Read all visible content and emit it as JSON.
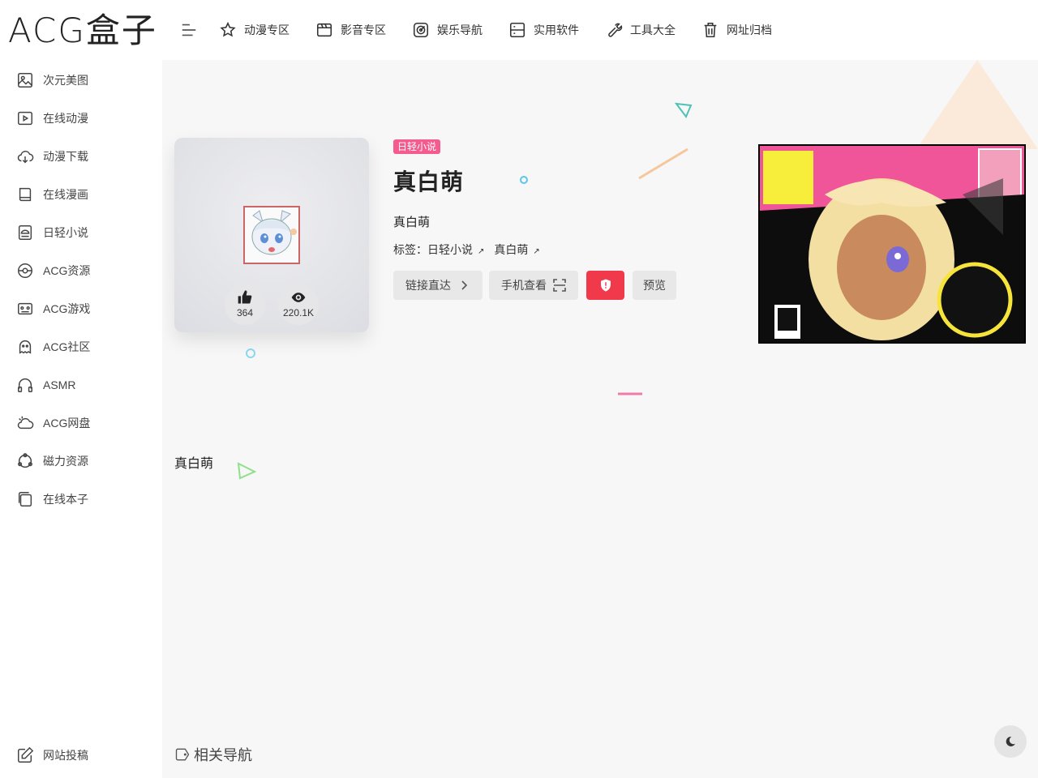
{
  "logo": "ACG盒子",
  "sidebar": {
    "items": [
      {
        "label": "次元美图",
        "icon": "image-icon"
      },
      {
        "label": "在线动漫",
        "icon": "play-icon"
      },
      {
        "label": "动漫下载",
        "icon": "cloud-download-icon"
      },
      {
        "label": "在线漫画",
        "icon": "book-icon"
      },
      {
        "label": "日轻小说",
        "icon": "novel-icon"
      },
      {
        "label": "ACG资源",
        "icon": "pokeball-icon"
      },
      {
        "label": "ACG游戏",
        "icon": "gamepad-icon"
      },
      {
        "label": "ACG社区",
        "icon": "ghost-icon"
      },
      {
        "label": "ASMR",
        "icon": "headphones-icon"
      },
      {
        "label": "ACG网盘",
        "icon": "cloud-icon"
      },
      {
        "label": "磁力资源",
        "icon": "magnet-icon"
      },
      {
        "label": "在线本子",
        "icon": "copy-icon"
      }
    ],
    "submit": {
      "label": "网站投稿",
      "icon": "edit-icon"
    }
  },
  "nav": {
    "items": [
      {
        "label": "动漫专区",
        "icon": "star-icon"
      },
      {
        "label": "影音专区",
        "icon": "video-icon"
      },
      {
        "label": "娱乐导航",
        "icon": "target-icon"
      },
      {
        "label": "实用软件",
        "icon": "app-icon"
      },
      {
        "label": "工具大全",
        "icon": "wrench-icon"
      },
      {
        "label": "网址归档",
        "icon": "trash-icon"
      }
    ]
  },
  "site": {
    "category": "日轻小说",
    "title": "真白萌",
    "subtitle": "真白萌",
    "tags_prefix": "标签：",
    "tags": [
      "日轻小说",
      "真白萌"
    ],
    "likes": "364",
    "views": "220.1K",
    "buttons": {
      "direct": "链接直达",
      "mobile": "手机查看",
      "preview": "预览"
    },
    "content": "真白萌"
  },
  "related_title": "相关导航",
  "colors": {
    "badge": "#f45b8e",
    "report": "#f03a4c"
  }
}
